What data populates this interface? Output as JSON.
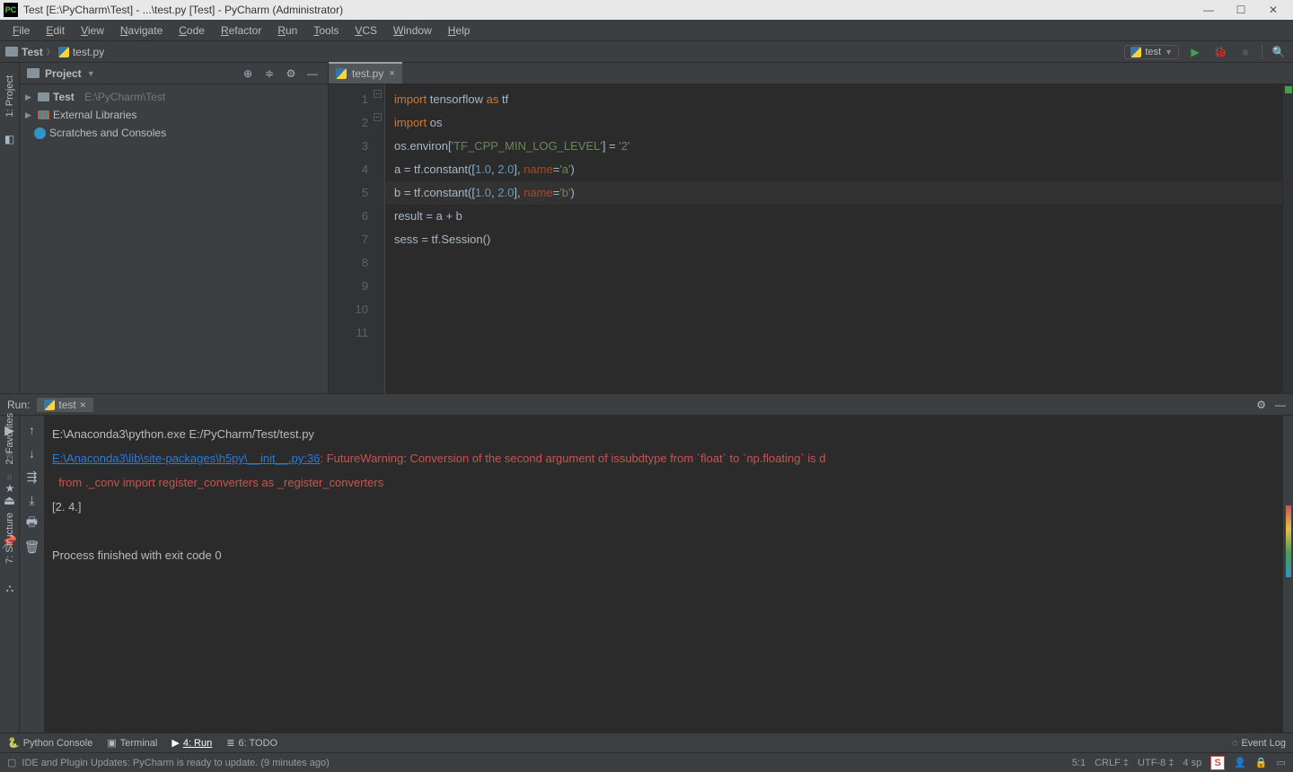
{
  "title": "Test [E:\\PyCharm\\Test] - ...\\test.py [Test] - PyCharm (Administrator)",
  "menu": [
    "File",
    "Edit",
    "View",
    "Navigate",
    "Code",
    "Refactor",
    "Run",
    "Tools",
    "VCS",
    "Window",
    "Help"
  ],
  "breadcrumb": {
    "root": "Test",
    "file": "test.py"
  },
  "runconfig": "test",
  "sidebar": {
    "title": "Project",
    "items": [
      {
        "label": "Test",
        "hint": "E:\\PyCharm\\Test",
        "kind": "folder"
      },
      {
        "label": "External Libraries",
        "kind": "lib"
      },
      {
        "label": "Scratches and Consoles",
        "kind": "scratch"
      }
    ]
  },
  "left_rail": [
    "1: Project"
  ],
  "left_rail2": [
    "2: Favorites",
    "7: Structure"
  ],
  "tab": "test.py",
  "code": {
    "lines": [
      [
        [
          "kw",
          "import "
        ],
        [
          "norm",
          "tensorflow "
        ],
        [
          "kw",
          "as "
        ],
        [
          "norm",
          "tf"
        ]
      ],
      [
        [
          "kw",
          "import "
        ],
        [
          "norm",
          "os"
        ]
      ],
      [
        [
          "norm",
          "os.environ["
        ],
        [
          "str",
          "'TF_CPP_MIN_LOG_LEVEL'"
        ],
        [
          "norm",
          "] = "
        ],
        [
          "str",
          "'2'"
        ]
      ],
      [
        [
          "norm",
          ""
        ]
      ],
      [
        [
          "norm",
          ""
        ]
      ],
      [
        [
          "norm",
          "a = tf.constant(["
        ],
        [
          "num",
          "1.0"
        ],
        [
          "norm",
          ", "
        ],
        [
          "num",
          "2.0"
        ],
        [
          "norm",
          "], "
        ],
        [
          "param",
          "name"
        ],
        [
          "norm",
          "="
        ],
        [
          "str",
          "'a'"
        ],
        [
          "norm",
          ")"
        ]
      ],
      [
        [
          "norm",
          "b = tf.constant(["
        ],
        [
          "num",
          "1.0"
        ],
        [
          "norm",
          ", "
        ],
        [
          "num",
          "2.0"
        ],
        [
          "norm",
          "], "
        ],
        [
          "param",
          "name"
        ],
        [
          "norm",
          "="
        ],
        [
          "str",
          "'b'"
        ],
        [
          "norm",
          ")"
        ]
      ],
      [
        [
          "norm",
          ""
        ]
      ],
      [
        [
          "norm",
          "result = a + b"
        ]
      ],
      [
        [
          "norm",
          ""
        ]
      ],
      [
        [
          "norm",
          "sess = tf.Session()"
        ]
      ]
    ]
  },
  "run": {
    "label": "Run:",
    "tab": "test",
    "out": {
      "cmd": "E:\\Anaconda3\\python.exe E:/PyCharm/Test/test.py",
      "link": "E:\\Anaconda3\\lib\\site-packages\\h5py\\__init__.py:36",
      "warn_rest": ": FutureWarning: Conversion of the second argument of issubdtype from `float` to `np.floating` is d",
      "warn2": "  from ._conv import register_converters as _register_converters",
      "result": "[2. 4.]",
      "blank": "",
      "exit": "Process finished with exit code 0"
    }
  },
  "bottom": {
    "items": [
      "Python Console",
      "Terminal",
      "4: Run",
      "6: TODO"
    ],
    "event": "Event Log"
  },
  "status": {
    "msg": "IDE and Plugin Updates: PyCharm is ready to update. (9 minutes ago)",
    "pos": "5:1",
    "crlf": "CRLF",
    "enc": "UTF-8",
    "spaces": "4 sp"
  }
}
